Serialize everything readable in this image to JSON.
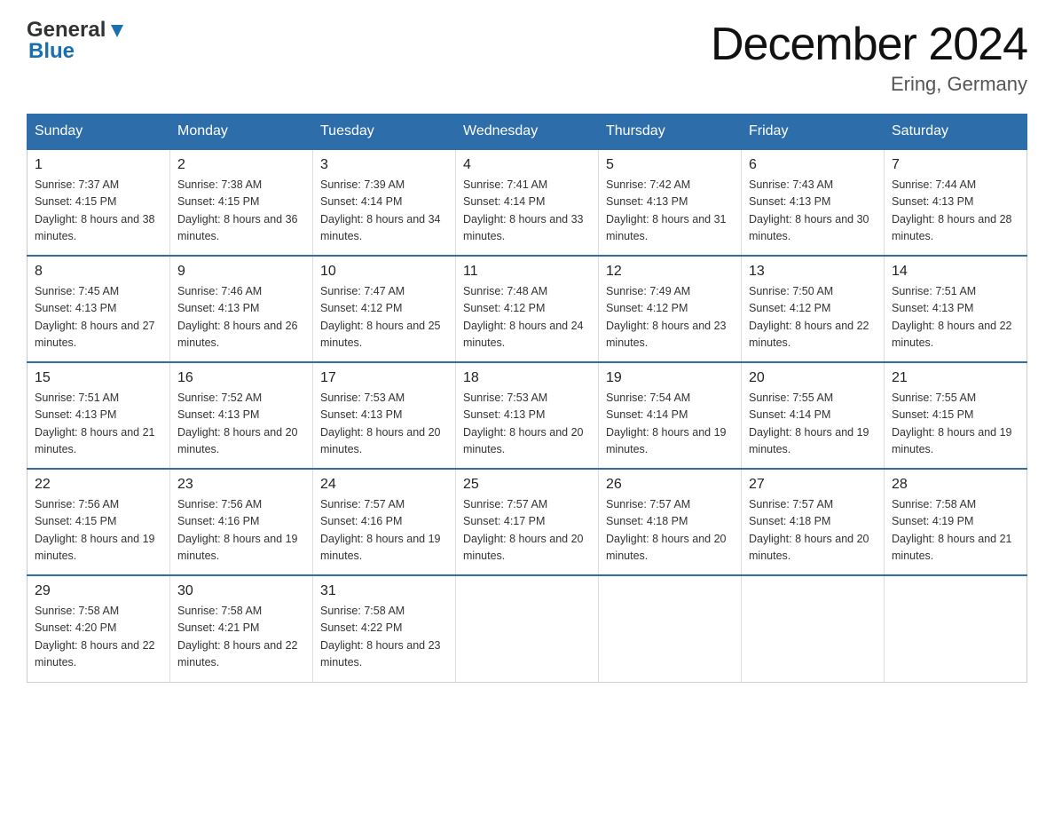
{
  "header": {
    "logo_general": "General",
    "logo_blue": "Blue",
    "month_title": "December 2024",
    "location": "Ering, Germany"
  },
  "weekdays": [
    "Sunday",
    "Monday",
    "Tuesday",
    "Wednesday",
    "Thursday",
    "Friday",
    "Saturday"
  ],
  "weeks": [
    [
      {
        "day": "1",
        "sunrise": "Sunrise: 7:37 AM",
        "sunset": "Sunset: 4:15 PM",
        "daylight": "Daylight: 8 hours and 38 minutes."
      },
      {
        "day": "2",
        "sunrise": "Sunrise: 7:38 AM",
        "sunset": "Sunset: 4:15 PM",
        "daylight": "Daylight: 8 hours and 36 minutes."
      },
      {
        "day": "3",
        "sunrise": "Sunrise: 7:39 AM",
        "sunset": "Sunset: 4:14 PM",
        "daylight": "Daylight: 8 hours and 34 minutes."
      },
      {
        "day": "4",
        "sunrise": "Sunrise: 7:41 AM",
        "sunset": "Sunset: 4:14 PM",
        "daylight": "Daylight: 8 hours and 33 minutes."
      },
      {
        "day": "5",
        "sunrise": "Sunrise: 7:42 AM",
        "sunset": "Sunset: 4:13 PM",
        "daylight": "Daylight: 8 hours and 31 minutes."
      },
      {
        "day": "6",
        "sunrise": "Sunrise: 7:43 AM",
        "sunset": "Sunset: 4:13 PM",
        "daylight": "Daylight: 8 hours and 30 minutes."
      },
      {
        "day": "7",
        "sunrise": "Sunrise: 7:44 AM",
        "sunset": "Sunset: 4:13 PM",
        "daylight": "Daylight: 8 hours and 28 minutes."
      }
    ],
    [
      {
        "day": "8",
        "sunrise": "Sunrise: 7:45 AM",
        "sunset": "Sunset: 4:13 PM",
        "daylight": "Daylight: 8 hours and 27 minutes."
      },
      {
        "day": "9",
        "sunrise": "Sunrise: 7:46 AM",
        "sunset": "Sunset: 4:13 PM",
        "daylight": "Daylight: 8 hours and 26 minutes."
      },
      {
        "day": "10",
        "sunrise": "Sunrise: 7:47 AM",
        "sunset": "Sunset: 4:12 PM",
        "daylight": "Daylight: 8 hours and 25 minutes."
      },
      {
        "day": "11",
        "sunrise": "Sunrise: 7:48 AM",
        "sunset": "Sunset: 4:12 PM",
        "daylight": "Daylight: 8 hours and 24 minutes."
      },
      {
        "day": "12",
        "sunrise": "Sunrise: 7:49 AM",
        "sunset": "Sunset: 4:12 PM",
        "daylight": "Daylight: 8 hours and 23 minutes."
      },
      {
        "day": "13",
        "sunrise": "Sunrise: 7:50 AM",
        "sunset": "Sunset: 4:12 PM",
        "daylight": "Daylight: 8 hours and 22 minutes."
      },
      {
        "day": "14",
        "sunrise": "Sunrise: 7:51 AM",
        "sunset": "Sunset: 4:13 PM",
        "daylight": "Daylight: 8 hours and 22 minutes."
      }
    ],
    [
      {
        "day": "15",
        "sunrise": "Sunrise: 7:51 AM",
        "sunset": "Sunset: 4:13 PM",
        "daylight": "Daylight: 8 hours and 21 minutes."
      },
      {
        "day": "16",
        "sunrise": "Sunrise: 7:52 AM",
        "sunset": "Sunset: 4:13 PM",
        "daylight": "Daylight: 8 hours and 20 minutes."
      },
      {
        "day": "17",
        "sunrise": "Sunrise: 7:53 AM",
        "sunset": "Sunset: 4:13 PM",
        "daylight": "Daylight: 8 hours and 20 minutes."
      },
      {
        "day": "18",
        "sunrise": "Sunrise: 7:53 AM",
        "sunset": "Sunset: 4:13 PM",
        "daylight": "Daylight: 8 hours and 20 minutes."
      },
      {
        "day": "19",
        "sunrise": "Sunrise: 7:54 AM",
        "sunset": "Sunset: 4:14 PM",
        "daylight": "Daylight: 8 hours and 19 minutes."
      },
      {
        "day": "20",
        "sunrise": "Sunrise: 7:55 AM",
        "sunset": "Sunset: 4:14 PM",
        "daylight": "Daylight: 8 hours and 19 minutes."
      },
      {
        "day": "21",
        "sunrise": "Sunrise: 7:55 AM",
        "sunset": "Sunset: 4:15 PM",
        "daylight": "Daylight: 8 hours and 19 minutes."
      }
    ],
    [
      {
        "day": "22",
        "sunrise": "Sunrise: 7:56 AM",
        "sunset": "Sunset: 4:15 PM",
        "daylight": "Daylight: 8 hours and 19 minutes."
      },
      {
        "day": "23",
        "sunrise": "Sunrise: 7:56 AM",
        "sunset": "Sunset: 4:16 PM",
        "daylight": "Daylight: 8 hours and 19 minutes."
      },
      {
        "day": "24",
        "sunrise": "Sunrise: 7:57 AM",
        "sunset": "Sunset: 4:16 PM",
        "daylight": "Daylight: 8 hours and 19 minutes."
      },
      {
        "day": "25",
        "sunrise": "Sunrise: 7:57 AM",
        "sunset": "Sunset: 4:17 PM",
        "daylight": "Daylight: 8 hours and 20 minutes."
      },
      {
        "day": "26",
        "sunrise": "Sunrise: 7:57 AM",
        "sunset": "Sunset: 4:18 PM",
        "daylight": "Daylight: 8 hours and 20 minutes."
      },
      {
        "day": "27",
        "sunrise": "Sunrise: 7:57 AM",
        "sunset": "Sunset: 4:18 PM",
        "daylight": "Daylight: 8 hours and 20 minutes."
      },
      {
        "day": "28",
        "sunrise": "Sunrise: 7:58 AM",
        "sunset": "Sunset: 4:19 PM",
        "daylight": "Daylight: 8 hours and 21 minutes."
      }
    ],
    [
      {
        "day": "29",
        "sunrise": "Sunrise: 7:58 AM",
        "sunset": "Sunset: 4:20 PM",
        "daylight": "Daylight: 8 hours and 22 minutes."
      },
      {
        "day": "30",
        "sunrise": "Sunrise: 7:58 AM",
        "sunset": "Sunset: 4:21 PM",
        "daylight": "Daylight: 8 hours and 22 minutes."
      },
      {
        "day": "31",
        "sunrise": "Sunrise: 7:58 AM",
        "sunset": "Sunset: 4:22 PM",
        "daylight": "Daylight: 8 hours and 23 minutes."
      },
      null,
      null,
      null,
      null
    ]
  ]
}
